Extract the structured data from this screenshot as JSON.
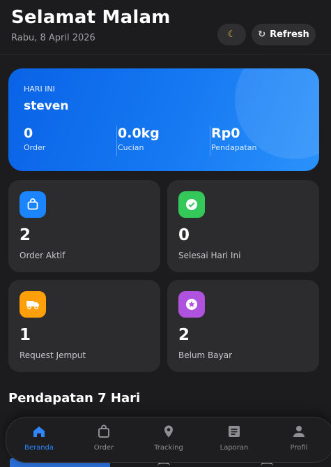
{
  "header": {
    "greeting": "Selamat Malam",
    "date": "Rabu, 8 April 2026",
    "theme_toggle_icon": "moon-icon",
    "refresh_label": "Refresh"
  },
  "summary": {
    "label": "HARI INI",
    "user": "steven",
    "stats": [
      {
        "value": "0",
        "label": "Order"
      },
      {
        "value": "0.0kg",
        "label": "Cucian"
      },
      {
        "value": "Rp0",
        "label": "Pendapatan"
      }
    ]
  },
  "cards": [
    {
      "icon": "bag-icon",
      "color": "#1a85ff",
      "value": "2",
      "label": "Order Aktif"
    },
    {
      "icon": "check-circle-icon",
      "color": "#34c759",
      "value": "0",
      "label": "Selesai Hari Ini"
    },
    {
      "icon": "truck-icon",
      "color": "#ff9f0a",
      "value": "1",
      "label": "Request Jemput"
    },
    {
      "icon": "star-badge-icon",
      "color": "#af52de",
      "value": "2",
      "label": "Belum Bayar"
    }
  ],
  "section_title": "Pendapatan 7 Hari",
  "nav": [
    {
      "label": "Beranda",
      "icon": "home-icon",
      "active": true
    },
    {
      "label": "Order",
      "icon": "bag-icon",
      "active": false
    },
    {
      "label": "Tracking",
      "icon": "location-pin-icon",
      "active": false
    },
    {
      "label": "Laporan",
      "icon": "report-icon",
      "active": false
    },
    {
      "label": "Profil",
      "icon": "person-icon",
      "active": false
    }
  ],
  "colors": {
    "background": "#1c1c1e",
    "card": "#2c2c2e",
    "accent": "#2f86ff"
  }
}
